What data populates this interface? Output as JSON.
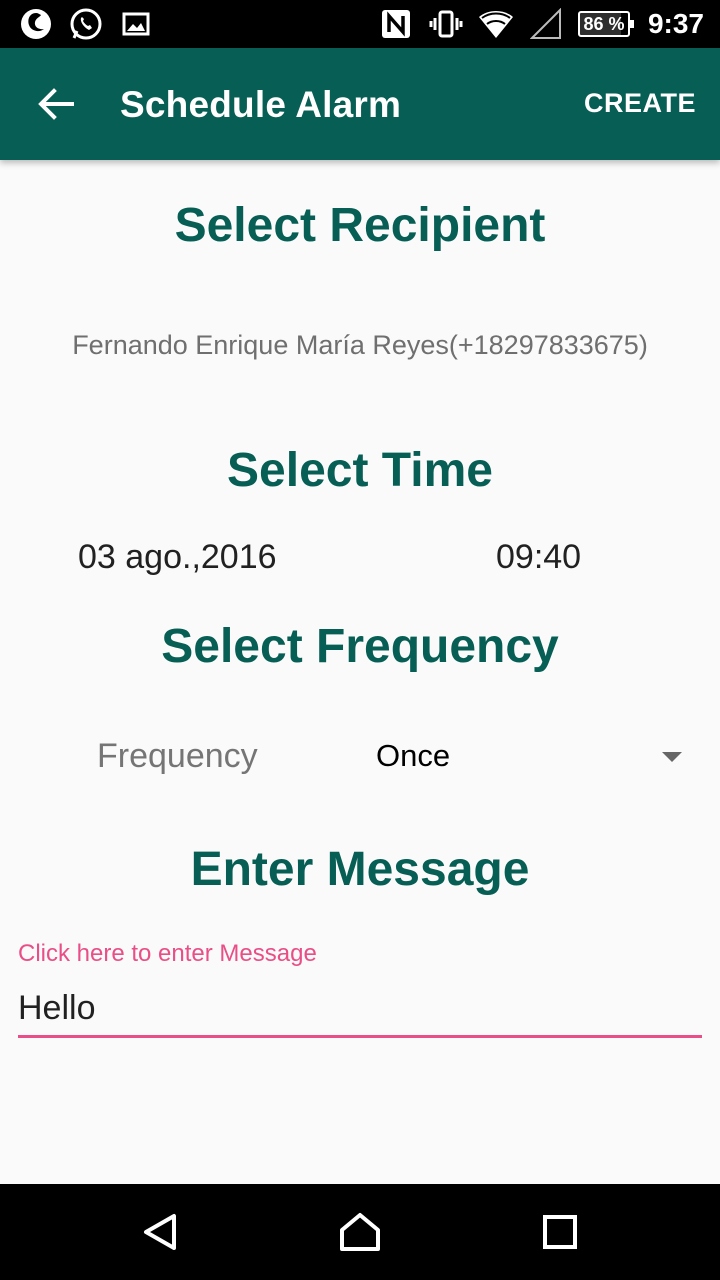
{
  "status_bar": {
    "battery_percent": 86,
    "battery_text": "86 %",
    "time": "9:37",
    "left_icons": [
      "firefox-icon",
      "whatsapp-icon",
      "gallery-icon"
    ],
    "right_icons": [
      "nfc-icon",
      "vibrate-icon",
      "wifi-icon",
      "signal-icon"
    ]
  },
  "app_bar": {
    "title": "Schedule Alarm",
    "action_label": "CREATE",
    "color": "#075e54"
  },
  "recipient": {
    "heading": "Select Recipient",
    "value": "Fernando Enrique María Reyes(+18297833675)"
  },
  "time": {
    "heading": "Select Time",
    "date": "03 ago.,2016",
    "time": "09:40"
  },
  "frequency": {
    "heading": "Select Frequency",
    "label": "Frequency",
    "selected": "Once"
  },
  "message": {
    "heading": "Enter Message",
    "hint": "Click here to enter Message",
    "value": "Hello",
    "accent_color": "#e94e86"
  },
  "nav_bar": {
    "icons": [
      "back-icon",
      "home-icon",
      "recents-icon"
    ]
  }
}
